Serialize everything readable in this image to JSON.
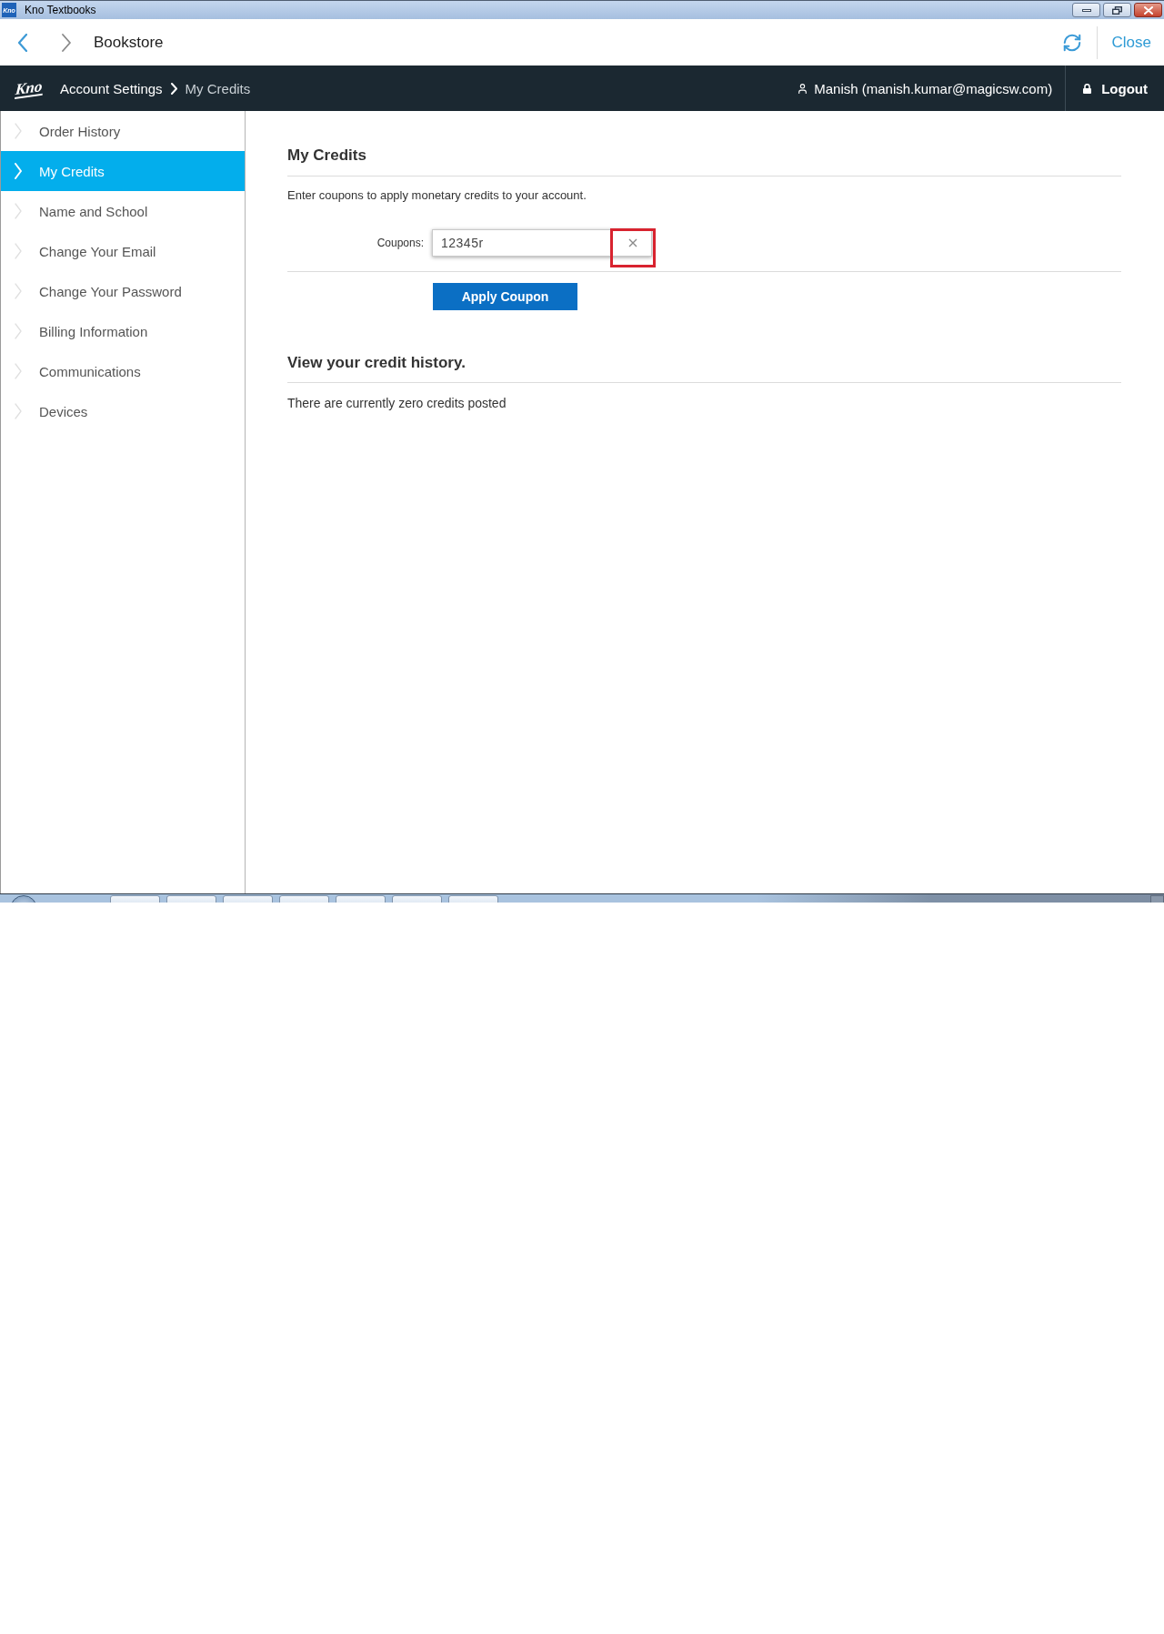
{
  "window": {
    "icon": "Kno",
    "title": "Kno Textbooks"
  },
  "top_bar": {
    "title": "Bookstore",
    "close": "Close"
  },
  "nav_bar": {
    "logo": "Kno",
    "breadcrumb": [
      {
        "label": "Account Settings",
        "current": false
      },
      {
        "label": "My Credits",
        "current": true
      }
    ],
    "user": "Manish (manish.kumar@magicsw.com)",
    "logout": "Logout"
  },
  "sidebar": {
    "items": [
      {
        "label": "Order History",
        "selected": false
      },
      {
        "label": "My Credits",
        "selected": true
      },
      {
        "label": "Name and School",
        "selected": false
      },
      {
        "label": "Change Your Email",
        "selected": false
      },
      {
        "label": "Change Your Password",
        "selected": false
      },
      {
        "label": "Billing Information",
        "selected": false
      },
      {
        "label": "Communications",
        "selected": false
      },
      {
        "label": "Devices",
        "selected": false
      }
    ]
  },
  "main": {
    "title": "My Credits",
    "intro": "Enter coupons to apply monetary credits to your account.",
    "coupon": {
      "label": "Coupons:",
      "value": "12345r",
      "highlighted": true
    },
    "apply_button": "Apply Coupon",
    "history": {
      "title": "View your credit history.",
      "message": "There are currently zero credits posted"
    }
  }
}
